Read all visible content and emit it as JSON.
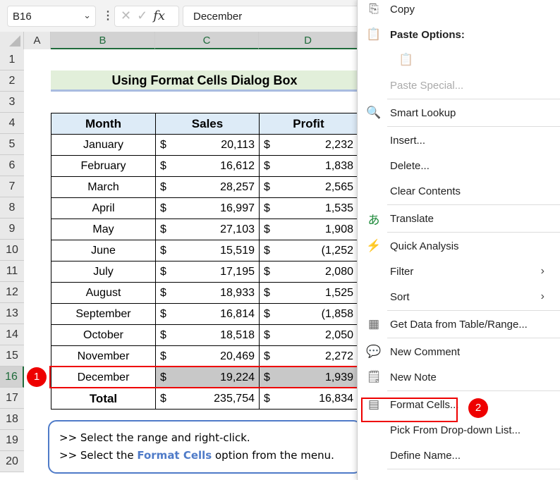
{
  "formula_bar": {
    "name_box": "B16",
    "formula": "December",
    "fx": "fx"
  },
  "columns": [
    "A",
    "B",
    "C",
    "D"
  ],
  "rows": [
    "1",
    "2",
    "3",
    "4",
    "5",
    "6",
    "7",
    "8",
    "9",
    "10",
    "11",
    "12",
    "13",
    "14",
    "15",
    "16",
    "17",
    "18",
    "19",
    "20"
  ],
  "selected_row": "16",
  "title": "Using Format Cells Dialog Box",
  "table": {
    "headers": [
      "Month",
      "Sales",
      "Profit"
    ],
    "currency": "$",
    "rows": [
      [
        "January",
        "20,113",
        "2,232"
      ],
      [
        "February",
        "16,612",
        "1,838"
      ],
      [
        "March",
        "28,257",
        "2,565"
      ],
      [
        "April",
        "16,997",
        "1,535"
      ],
      [
        "May",
        "27,103",
        "1,908"
      ],
      [
        "June",
        "15,519",
        "(1,252"
      ],
      [
        "July",
        "17,195",
        "2,080"
      ],
      [
        "August",
        "18,933",
        "1,525"
      ],
      [
        "September",
        "16,814",
        "(1,858"
      ],
      [
        "October",
        "18,518",
        "2,050"
      ],
      [
        "November",
        "20,469",
        "2,272"
      ],
      [
        "December",
        "19,224",
        "1,939"
      ]
    ],
    "total": [
      "Total",
      "235,754",
      "16,834"
    ]
  },
  "note": {
    "line1": ">> Select the range and right-click.",
    "line2_pre": ">> Select the ",
    "line2_bold": "Format Cells",
    "line2_post": " option from the menu."
  },
  "badges": [
    "1",
    "2"
  ],
  "colors": {
    "accent_red": "#ee0000",
    "note_blue": "#4f7bc8",
    "header_fill": "#ddebf7",
    "title_fill": "#e2efda"
  },
  "menu": {
    "items": [
      {
        "label": "Copy",
        "icon": "copy-icon"
      },
      {
        "label": "Paste Options:",
        "icon": "paste-icon",
        "bold": true
      },
      {
        "label": "",
        "icon": "paste-icon"
      },
      {
        "label": "Paste Special...",
        "disabled": true
      },
      {
        "sep": true
      },
      {
        "label": "Smart Lookup",
        "icon": "smart-lookup-icon"
      },
      {
        "sep": true
      },
      {
        "label": "Insert..."
      },
      {
        "label": "Delete..."
      },
      {
        "label": "Clear Contents"
      },
      {
        "sep": true
      },
      {
        "label": "Translate",
        "icon": "translate-icon"
      },
      {
        "sep": true
      },
      {
        "label": "Quick Analysis",
        "icon": "quick-analysis-icon"
      },
      {
        "label": "Filter",
        "submenu": true
      },
      {
        "label": "Sort",
        "submenu": true
      },
      {
        "sep": true
      },
      {
        "label": "Get Data from Table/Range...",
        "icon": "table-icon"
      },
      {
        "sep": true
      },
      {
        "label": "New Comment",
        "icon": "new-comment-icon"
      },
      {
        "label": "New Note",
        "icon": "new-note-icon"
      },
      {
        "sep": true
      },
      {
        "label": "Format Cells...",
        "icon": "format-cells-icon"
      },
      {
        "label": "Pick From Drop-down List..."
      },
      {
        "label": "Define Name..."
      },
      {
        "sep": true
      }
    ]
  }
}
